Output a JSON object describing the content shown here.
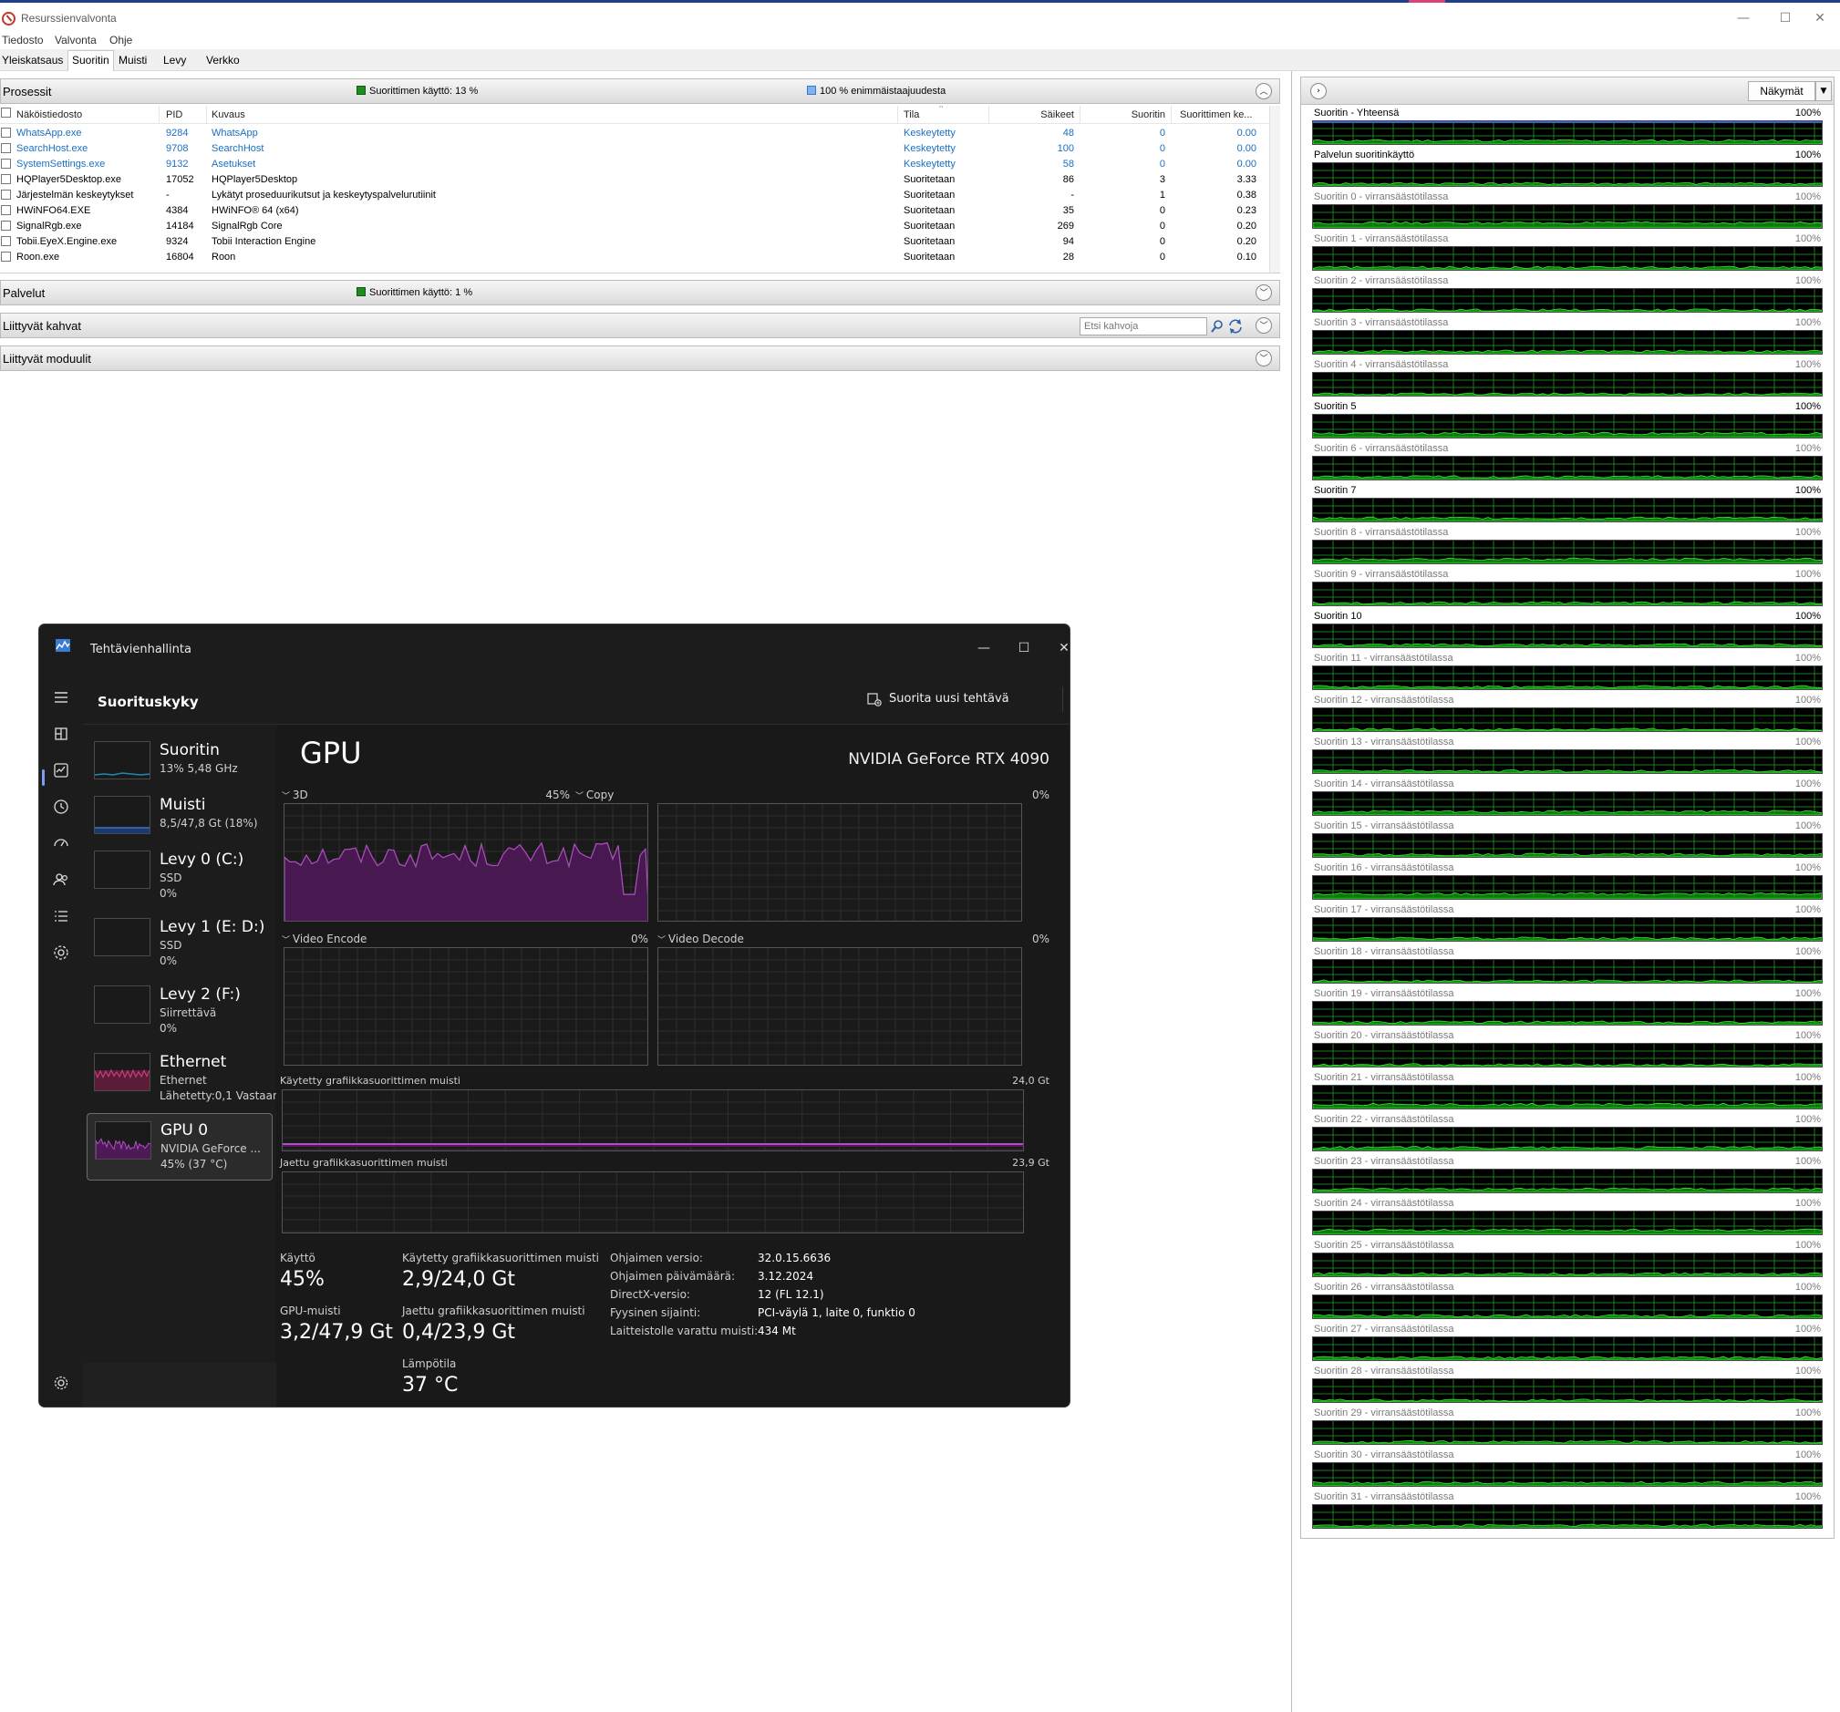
{
  "resmon": {
    "title": "Resurssienvalvonta",
    "menu": [
      "Tiedosto",
      "Valvonta",
      "Ohje"
    ],
    "tabs": [
      "Yleiskatsaus",
      "Suoritin",
      "Muisti",
      "Levy",
      "Verkko"
    ],
    "active_tab": "Suoritin",
    "processes": {
      "title": "Prosessit",
      "cpu_usage": "Suorittimen käyttö: 13 %",
      "max_freq": "100 % enimmäistaajuudesta",
      "columns": [
        "Näköistiedosto",
        "PID",
        "Kuvaus",
        "Tila",
        "Säikeet",
        "Suoritin",
        "Suorittimen ke..."
      ],
      "rows": [
        {
          "image": "WhatsApp.exe",
          "pid": "9284",
          "desc": "WhatsApp",
          "state": "Keskeytetty",
          "threads": "48",
          "cpu": "0",
          "avg": "0.00",
          "suspended": true
        },
        {
          "image": "SearchHost.exe",
          "pid": "9708",
          "desc": "SearchHost",
          "state": "Keskeytetty",
          "threads": "100",
          "cpu": "0",
          "avg": "0.00",
          "suspended": true
        },
        {
          "image": "SystemSettings.exe",
          "pid": "9132",
          "desc": "Asetukset",
          "state": "Keskeytetty",
          "threads": "58",
          "cpu": "0",
          "avg": "0.00",
          "suspended": true
        },
        {
          "image": "HQPlayer5Desktop.exe",
          "pid": "17052",
          "desc": "HQPlayer5Desktop",
          "state": "Suoritetaan",
          "threads": "86",
          "cpu": "3",
          "avg": "3.33",
          "suspended": false
        },
        {
          "image": "Järjestelmän keskeytykset",
          "pid": "-",
          "desc": "Lykätyt proseduurikutsut ja keskeytyspalvelurutiinit",
          "state": "Suoritetaan",
          "threads": "-",
          "cpu": "1",
          "avg": "0.38",
          "suspended": false
        },
        {
          "image": "HWiNFO64.EXE",
          "pid": "4384",
          "desc": "HWiNFO® 64 (x64)",
          "state": "Suoritetaan",
          "threads": "35",
          "cpu": "0",
          "avg": "0.23",
          "suspended": false
        },
        {
          "image": "SignalRgb.exe",
          "pid": "14184",
          "desc": "SignalRgb Core",
          "state": "Suoritetaan",
          "threads": "269",
          "cpu": "0",
          "avg": "0.20",
          "suspended": false
        },
        {
          "image": "Tobii.EyeX.Engine.exe",
          "pid": "9324",
          "desc": "Tobii Interaction Engine",
          "state": "Suoritetaan",
          "threads": "94",
          "cpu": "0",
          "avg": "0.20",
          "suspended": false
        },
        {
          "image": "Roon.exe",
          "pid": "16804",
          "desc": "Roon",
          "state": "Suoritetaan",
          "threads": "28",
          "cpu": "0",
          "avg": "0.10",
          "suspended": false
        }
      ]
    },
    "services": {
      "title": "Palvelut",
      "cpu_usage": "Suorittimen käyttö: 1 %"
    },
    "handles": {
      "title": "Liittyvät kahvat",
      "search_placeholder": "Etsi kahvoja"
    },
    "modules": {
      "title": "Liittyvät moduulit"
    },
    "views_label": "Näkymät",
    "cpu_charts": [
      {
        "name": "Suoritin - Yhteensä",
        "pct": "100%",
        "active": true
      },
      {
        "name": "Palvelun suoritinkäyttö",
        "pct": "100%",
        "active": true
      },
      {
        "name": "Suoritin 0 - virransäästötilassa",
        "pct": "100%",
        "active": false
      },
      {
        "name": "Suoritin 1 - virransäästötilassa",
        "pct": "100%",
        "active": false
      },
      {
        "name": "Suoritin 2 - virransäästötilassa",
        "pct": "100%",
        "active": false
      },
      {
        "name": "Suoritin 3 - virransäästötilassa",
        "pct": "100%",
        "active": false
      },
      {
        "name": "Suoritin 4 - virransäästötilassa",
        "pct": "100%",
        "active": false
      },
      {
        "name": "Suoritin 5",
        "pct": "100%",
        "active": true
      },
      {
        "name": "Suoritin 6 - virransäästötilassa",
        "pct": "100%",
        "active": false
      },
      {
        "name": "Suoritin 7",
        "pct": "100%",
        "active": true
      },
      {
        "name": "Suoritin 8 - virransäästötilassa",
        "pct": "100%",
        "active": false
      },
      {
        "name": "Suoritin 9 - virransäästötilassa",
        "pct": "100%",
        "active": false
      },
      {
        "name": "Suoritin 10",
        "pct": "100%",
        "active": true
      },
      {
        "name": "Suoritin 11 - virransäästötilassa",
        "pct": "100%",
        "active": false
      },
      {
        "name": "Suoritin 12 - virransäästötilassa",
        "pct": "100%",
        "active": false
      },
      {
        "name": "Suoritin 13 - virransäästötilassa",
        "pct": "100%",
        "active": false
      },
      {
        "name": "Suoritin 14 - virransäästötilassa",
        "pct": "100%",
        "active": false
      },
      {
        "name": "Suoritin 15 - virransäästötilassa",
        "pct": "100%",
        "active": false
      },
      {
        "name": "Suoritin 16 - virransäästötilassa",
        "pct": "100%",
        "active": false
      },
      {
        "name": "Suoritin 17 - virransäästötilassa",
        "pct": "100%",
        "active": false
      },
      {
        "name": "Suoritin 18 - virransäästötilassa",
        "pct": "100%",
        "active": false
      },
      {
        "name": "Suoritin 19 - virransäästötilassa",
        "pct": "100%",
        "active": false
      },
      {
        "name": "Suoritin 20 - virransäästötilassa",
        "pct": "100%",
        "active": false
      },
      {
        "name": "Suoritin 21 - virransäästötilassa",
        "pct": "100%",
        "active": false
      },
      {
        "name": "Suoritin 22 - virransäästötilassa",
        "pct": "100%",
        "active": false
      },
      {
        "name": "Suoritin 23 - virransäästötilassa",
        "pct": "100%",
        "active": false
      },
      {
        "name": "Suoritin 24 - virransäästötilassa",
        "pct": "100%",
        "active": false
      },
      {
        "name": "Suoritin 25 - virransäästötilassa",
        "pct": "100%",
        "active": false
      },
      {
        "name": "Suoritin 26 - virransäästötilassa",
        "pct": "100%",
        "active": false
      },
      {
        "name": "Suoritin 27 - virransäästötilassa",
        "pct": "100%",
        "active": false
      },
      {
        "name": "Suoritin 28 - virransäästötilassa",
        "pct": "100%",
        "active": false
      },
      {
        "name": "Suoritin 29 - virransäästötilassa",
        "pct": "100%",
        "active": false
      },
      {
        "name": "Suoritin 30 - virransäästötilassa",
        "pct": "100%",
        "active": false
      },
      {
        "name": "Suoritin 31 - virransäästötilassa",
        "pct": "100%",
        "active": false
      }
    ],
    "colors": {
      "cpu_green": "#1e8c1e",
      "max_freq_blue": "#4f8fe0",
      "suspended_blue": "#1a6fc4"
    }
  },
  "taskmgr": {
    "title": "Tehtävienhallinta",
    "section": "Suorituskyky",
    "run_new_task": "Suorita uusi tehtävä",
    "more": "···",
    "devices": [
      {
        "name": "Suoritin",
        "l1": "13% 5,48 GHz",
        "l2": ""
      },
      {
        "name": "Muisti",
        "l1": "8,5/47,8 Gt (18%)",
        "l2": ""
      },
      {
        "name": "Levy 0 (C:)",
        "l1": "SSD",
        "l2": "0%"
      },
      {
        "name": "Levy 1 (E: D:)",
        "l1": "SSD",
        "l2": "0%"
      },
      {
        "name": "Levy 2 (F:)",
        "l1": "Siirrettävä",
        "l2": "0%"
      },
      {
        "name": "Ethernet",
        "l1": "Ethernet",
        "l2": "Lähetetty:0,1 Vastaan"
      },
      {
        "name": "GPU 0",
        "l1": "NVIDIA GeForce ...",
        "l2": "45% (37 °C)"
      }
    ],
    "gpu": {
      "title": "GPU",
      "model": "NVIDIA GeForce RTX 4090",
      "engines": [
        {
          "label": "3D",
          "pct": "45%"
        },
        {
          "label": "Copy",
          "pct": "0%"
        },
        {
          "label": "Video Encode",
          "pct": "0%"
        },
        {
          "label": "Video Decode",
          "pct": "0%"
        }
      ],
      "dedicated_label": "Käytetty grafiikkasuorittimen muisti",
      "dedicated_max": "24,0 Gt",
      "shared_label": "Jaettu grafiikkasuorittimen muisti",
      "shared_max": "23,9 Gt",
      "stats": {
        "usage_label": "Käyttö",
        "usage": "45%",
        "gpu_mem_label": "GPU-muisti",
        "gpu_mem": "3,2/47,9 Gt",
        "ded_label": "Käytetty grafiikkasuorittimen muisti",
        "ded": "2,9/24,0 Gt",
        "shr_label": "Jaettu grafiikkasuorittimen muisti",
        "shr": "0,4/23,9 Gt",
        "temp_label": "Lämpötila",
        "temp": "37 °C"
      },
      "details": [
        {
          "k": "Ohjaimen versio:",
          "v": "32.0.15.6636"
        },
        {
          "k": "Ohjaimen päivämäärä:",
          "v": "3.12.2024"
        },
        {
          "k": "DirectX-versio:",
          "v": "12 (FL 12.1)"
        },
        {
          "k": "Fyysinen sijainti:",
          "v": "PCI-väylä 1, laite 0, funktio 0"
        },
        {
          "k": "Laitteistolle varattu muisti:",
          "v": "434 Mt"
        }
      ],
      "colors": {
        "gpu_purple": "#b14ec4",
        "gpu_fill": "#4d1a57"
      }
    }
  }
}
